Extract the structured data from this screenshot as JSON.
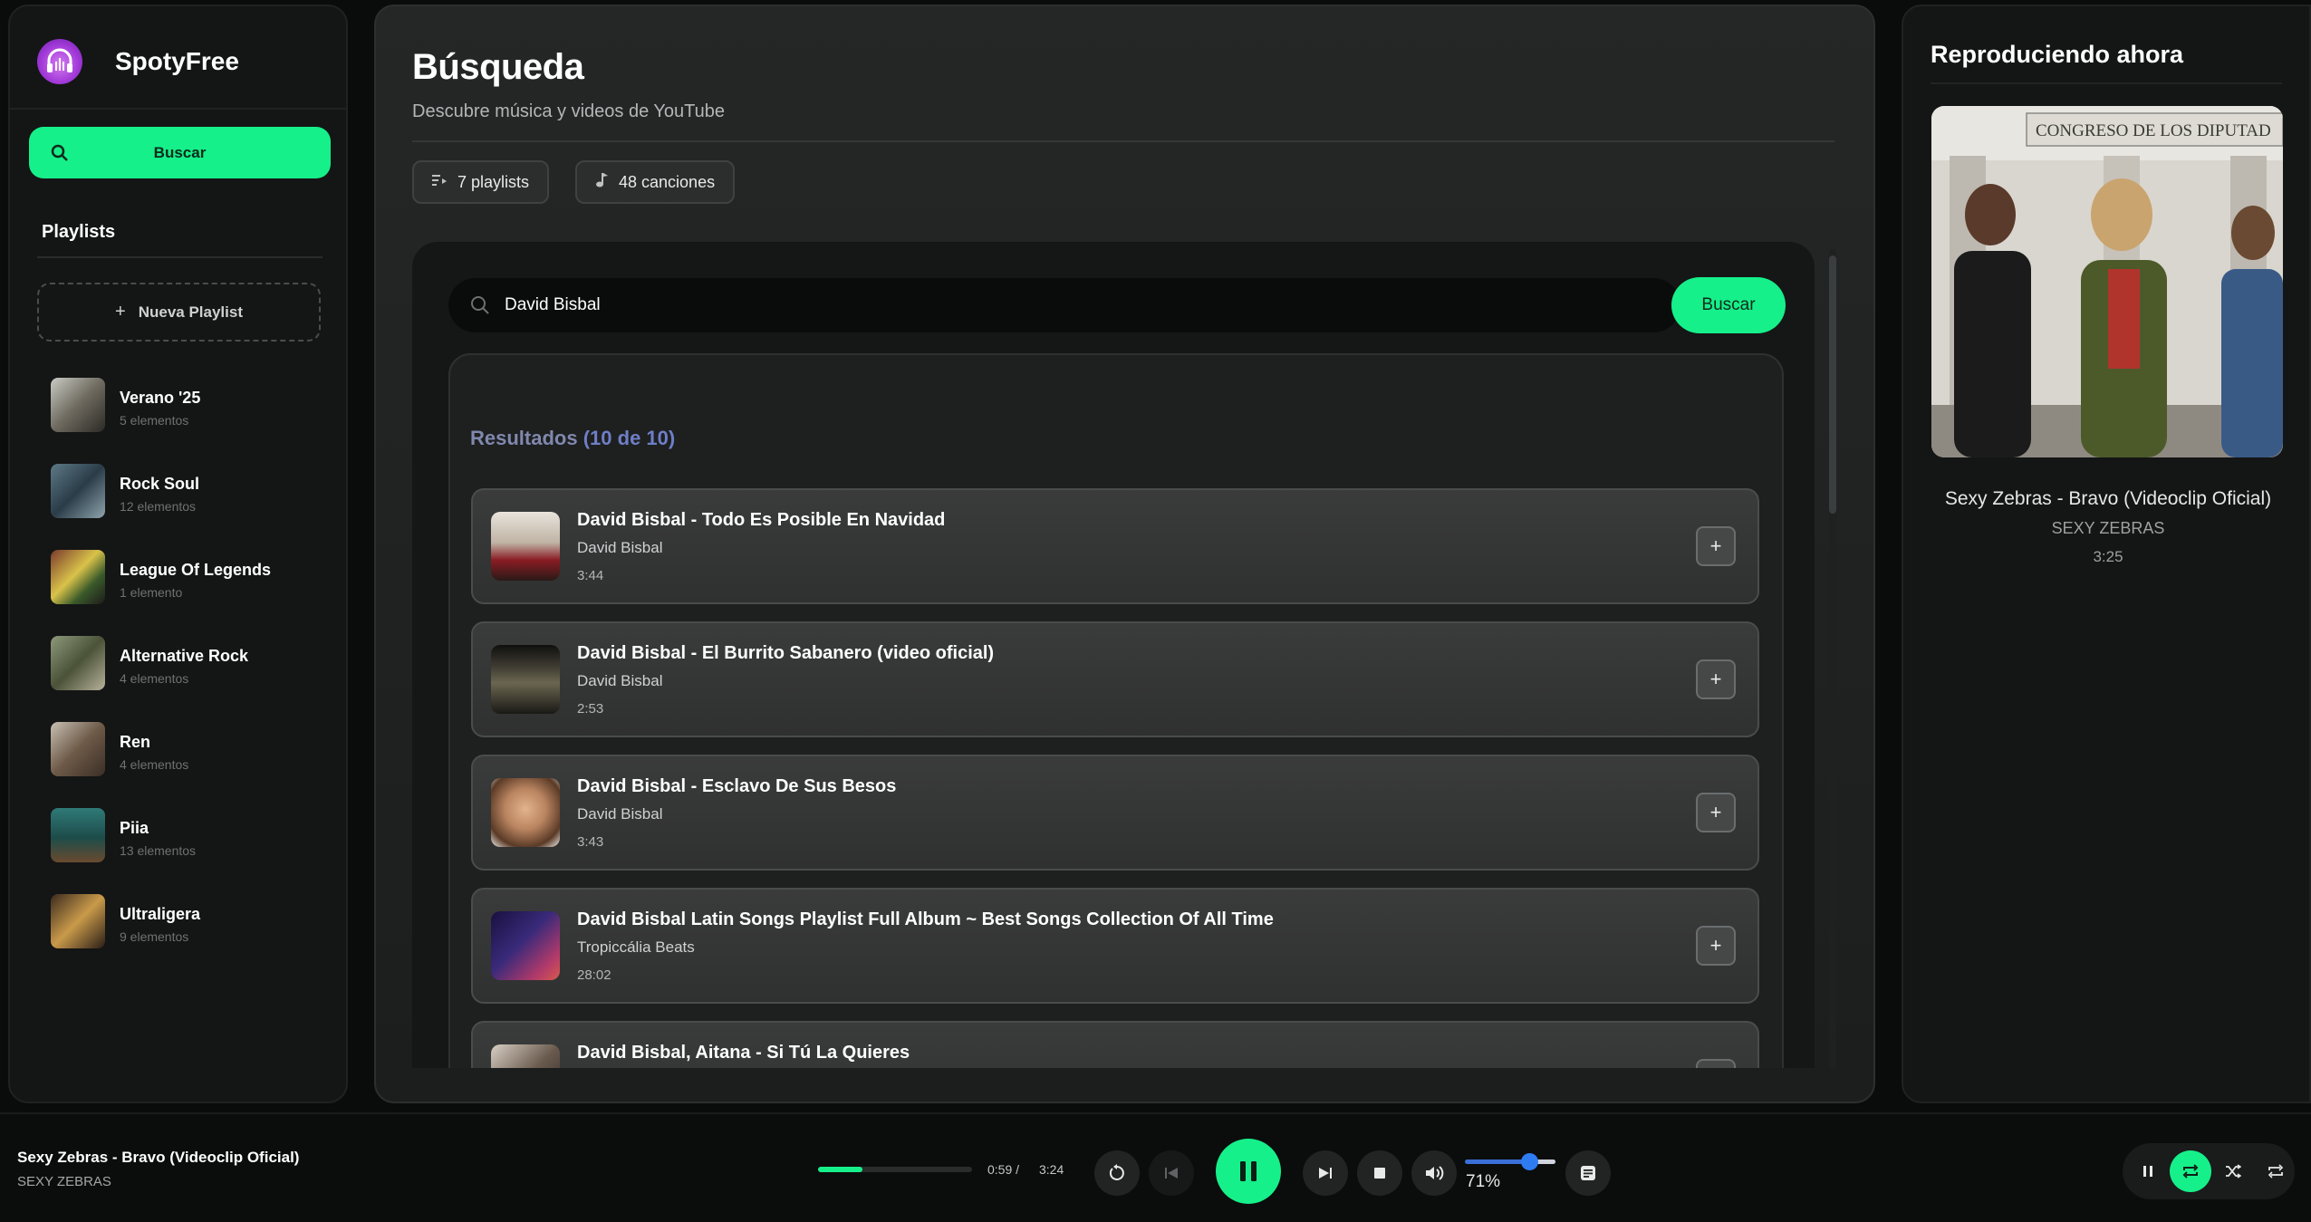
{
  "app": {
    "name": "SpotyFree"
  },
  "sidebar": {
    "search_label": "Buscar",
    "playlists_title": "Playlists",
    "new_playlist_label": "Nueva Playlist",
    "items": [
      {
        "name": "Verano '25",
        "count": "5 elementos"
      },
      {
        "name": "Rock Soul",
        "count": "12 elementos"
      },
      {
        "name": "League Of Legends",
        "count": "1 elemento"
      },
      {
        "name": "Alternative Rock",
        "count": "4 elementos"
      },
      {
        "name": "Ren",
        "count": "4 elementos"
      },
      {
        "name": "Piia",
        "count": "13 elementos"
      },
      {
        "name": "Ultraligera",
        "count": "9 elementos"
      }
    ]
  },
  "main": {
    "title": "Búsqueda",
    "subtitle": "Descubre música y videos de YouTube",
    "chips": {
      "playlists": "7 playlists",
      "songs": "48 canciones"
    },
    "search": {
      "value": "David Bisbal",
      "button": "Buscar"
    },
    "results": {
      "title": "Resultados",
      "count": "(10 de 10)",
      "items": [
        {
          "title": "David Bisbal - Todo Es Posible En Navidad",
          "artist": "David Bisbal",
          "duration": "3:44"
        },
        {
          "title": "David Bisbal - El Burrito Sabanero (video oficial)",
          "artist": "David Bisbal",
          "duration": "2:53"
        },
        {
          "title": "David Bisbal - Esclavo De Sus Besos",
          "artist": "David Bisbal",
          "duration": "3:43"
        },
        {
          "title": "David Bisbal Latin Songs Playlist Full Album ~ Best Songs Collection Of All Time",
          "artist": "Tropiccália Beats",
          "duration": "28:02"
        },
        {
          "title": "David Bisbal, Aitana - Si Tú La Quieres",
          "artist": "",
          "duration": ""
        }
      ]
    }
  },
  "now_playing": {
    "title": "Reproduciendo ahora",
    "art_caption": "CONGRESO DE LOS DIPUTAD",
    "song": "Sexy Zebras - Bravo (Videoclip Oficial)",
    "artist": "SEXY ZEBRAS",
    "duration": "3:25"
  },
  "player": {
    "song": "Sexy Zebras - Bravo (Videoclip Oficial)",
    "artist": "SEXY ZEBRAS",
    "elapsed": "0:59 /",
    "total": "3:24",
    "progress_fraction": 0.29,
    "volume": "71%",
    "volume_fraction": 0.71
  },
  "colors": {
    "accent": "#16f08a",
    "volume": "#2f7cf2",
    "results_count": "#6e7fc7"
  }
}
